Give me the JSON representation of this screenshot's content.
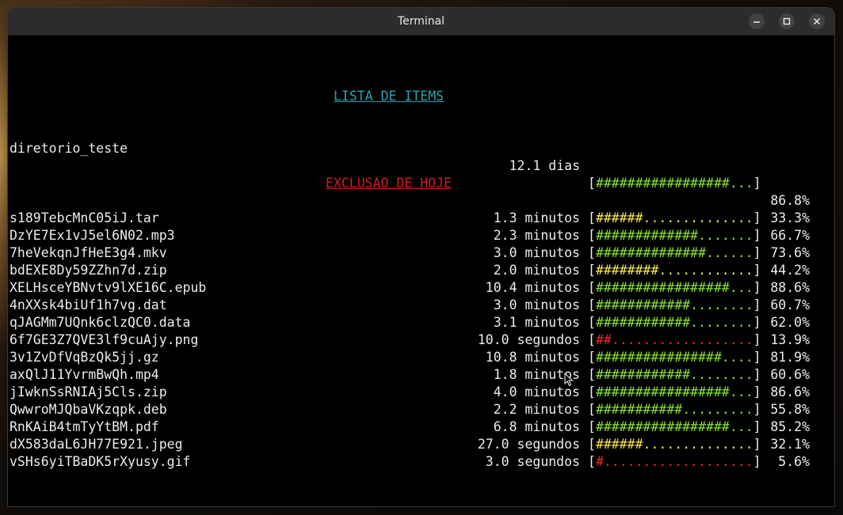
{
  "window": {
    "title": "Terminal"
  },
  "lista": {
    "heading": "LISTA DE ITEMS",
    "row": {
      "name": "diretorio_teste",
      "time": "12.1 dias",
      "hashes": "#################",
      "dots": "...",
      "pct": "86.8%",
      "color": "green"
    }
  },
  "exclusao": {
    "heading": "EXCLUSAO DE HOJE",
    "rows": [
      {
        "name": "s189TebcMnC05iJ.tar",
        "time": "1.3 minutos",
        "hashes": "######",
        "dots": "..............",
        "pct": "33.3%",
        "color": "yellow"
      },
      {
        "name": "DzYE7Ex1vJ5el6N02.mp3",
        "time": "2.3 minutos",
        "hashes": "#############",
        "dots": ".......",
        "pct": "66.7%",
        "color": "green"
      },
      {
        "name": "7heVekqnJfHeE3g4.mkv",
        "time": "3.0 minutos",
        "hashes": "##############",
        "dots": "......",
        "pct": "73.6%",
        "color": "green"
      },
      {
        "name": "bdEXE8Dy59ZZhn7d.zip",
        "time": "2.0 minutos",
        "hashes": "########",
        "dots": "............",
        "pct": "44.2%",
        "color": "yellow"
      },
      {
        "name": "XELHsceYBNvtv9lXE16C.epub",
        "time": "10.4 minutos",
        "hashes": "#################",
        "dots": "...",
        "pct": "88.6%",
        "color": "green"
      },
      {
        "name": "4nXXsk4biUf1h7vg.dat",
        "time": "3.0 minutos",
        "hashes": "############",
        "dots": "........",
        "pct": "60.7%",
        "color": "green"
      },
      {
        "name": "qJAGMm7UQnk6clzQC0.data",
        "time": "3.1 minutos",
        "hashes": "############",
        "dots": "........",
        "pct": "62.0%",
        "color": "green"
      },
      {
        "name": "6f7GE3Z7QVE3lf9cuAjy.png",
        "time": "10.0 segundos",
        "hashes": "##",
        "dots": "..................",
        "pct": "13.9%",
        "color": "red"
      },
      {
        "name": "3v1ZvDfVqBzQk5jj.gz",
        "time": "10.8 minutos",
        "hashes": "################",
        "dots": "....",
        "pct": "81.9%",
        "color": "green"
      },
      {
        "name": "axQlJ11YvrmBwQh.mp4",
        "time": "1.8 minutos",
        "hashes": "############",
        "dots": "........",
        "pct": "60.6%",
        "color": "green"
      },
      {
        "name": "jIwknSsRNIAj5Cls.zip",
        "time": "4.0 minutos",
        "hashes": "#################",
        "dots": "...",
        "pct": "86.6%",
        "color": "green"
      },
      {
        "name": "QwwroMJQbaVKzqpk.deb",
        "time": "2.2 minutos",
        "hashes": "###########",
        "dots": ".........",
        "pct": "55.8%",
        "color": "green"
      },
      {
        "name": "RnKAiB4tmTyYtBM.pdf",
        "time": "6.8 minutos",
        "hashes": "#################",
        "dots": "...",
        "pct": "85.2%",
        "color": "green"
      },
      {
        "name": "dX583daL6JH77E921.jpeg",
        "time": "27.0 segundos",
        "hashes": "######",
        "dots": "..............",
        "pct": "32.1%",
        "color": "yellow"
      },
      {
        "name": "vSHs6yiTBaDK5rXyusy.gif",
        "time": "3.0 segundos",
        "hashes": "#",
        "dots": "...................",
        "pct": "5.6%",
        "color": "red"
      }
    ]
  },
  "colors": {
    "heading_lista": "#2aa1b3",
    "heading_exclusao": "#d01b24",
    "green": "#8ae234",
    "yellow": "#fce94f",
    "red": "#ef2929"
  },
  "icons": {
    "minimize": "minimize-icon",
    "maximize": "maximize-icon",
    "close": "close-icon",
    "cursor": "mouse-pointer-icon"
  }
}
